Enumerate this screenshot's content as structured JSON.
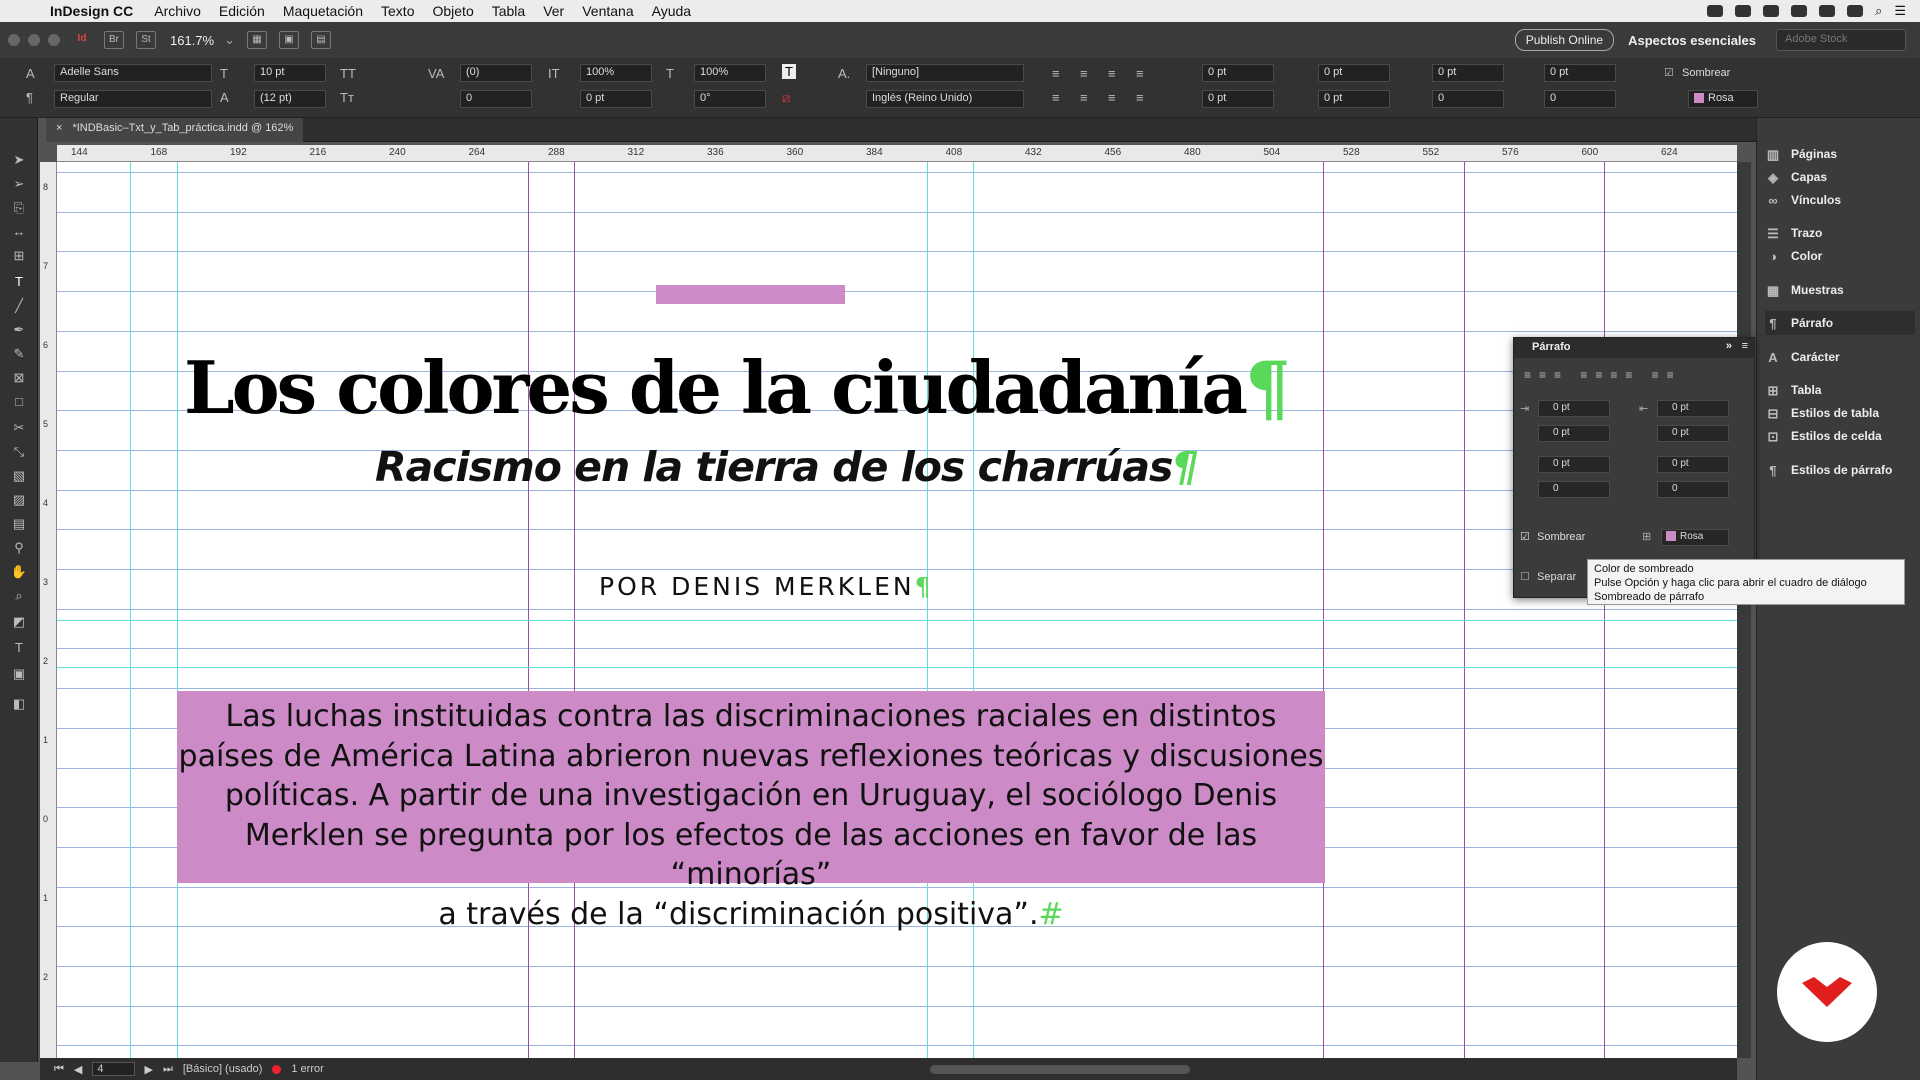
{
  "menubar": {
    "app_name": "InDesign CC",
    "items": [
      "Archivo",
      "Edición",
      "Maquetación",
      "Texto",
      "Objeto",
      "Tabla",
      "Ver",
      "Ventana",
      "Ayuda"
    ]
  },
  "appbar": {
    "zoom": "161.7%",
    "publish": "Publish Online",
    "workspace": "Aspectos esenciales",
    "stock_placeholder": "Adobe Stock",
    "br": "Br",
    "st": "St"
  },
  "control": {
    "font_family": "Adelle Sans",
    "font_style": "Regular",
    "font_size": "10 pt",
    "leading": "(12 pt)",
    "kerning": "(0)",
    "tracking": "0",
    "vscale": "100%",
    "hscale": "100%",
    "baseline": "0 pt",
    "skew": "0°",
    "char_style": "[Ninguno]",
    "language": "Inglés (Reino Unido)",
    "indent_fields": [
      "0 pt",
      "0 pt",
      "0 pt",
      "0 pt",
      "0 pt",
      "0 pt",
      "0",
      "0"
    ],
    "shade_label": "Sombrear",
    "shade_color": "Rosa"
  },
  "document_tab": "*INDBasic–Txt_y_Tab_práctica.indd @ 162%",
  "ruler": {
    "h_ticks": [
      "144",
      "168",
      "192",
      "216",
      "240",
      "264",
      "288",
      "312",
      "336",
      "360",
      "384",
      "408",
      "432",
      "456",
      "480",
      "504",
      "528",
      "552",
      "576",
      "600",
      "624"
    ],
    "v_ticks": [
      "8",
      "7",
      "6",
      "5",
      "4",
      "3",
      "2",
      "1",
      "0",
      "1",
      "2"
    ]
  },
  "article": {
    "title": "Los colores de la ciudadanía",
    "subtitle": "Racismo en la tierra de los charrúas",
    "author": "POR DENIS MERKLEN",
    "lead": [
      "Las luchas instituidas contra las discriminaciones raciales en distintos",
      "países de América Latina abrieron nuevas reflexiones teóricas y discusiones",
      "políticas. A partir de una investigación en Uruguay, el sociólogo Denis",
      "Merklen se pregunta por los efectos de las acciones en favor de las “minorías”",
      "a través de la “discriminación positiva”."
    ],
    "pilcrow": "¶",
    "end_mark": "#"
  },
  "status": {
    "page": "4",
    "style": "[Básico] (usado)",
    "errors": "1 error"
  },
  "dock": [
    "Páginas",
    "Capas",
    "Vínculos",
    "Trazo",
    "Color",
    "Muestras",
    "Párrafo",
    "Carácter",
    "Tabla",
    "Estilos de tabla",
    "Estilos de celda",
    "Estilos de párrafo"
  ],
  "paragraph_panel": {
    "title": "Párrafo",
    "fields": [
      "0 pt",
      "0 pt",
      "0 pt",
      "0 pt",
      "0 pt",
      "0 pt",
      "0",
      "0"
    ],
    "shade_label": "Sombrear",
    "shade_color": "Rosa",
    "separate_label": "Separar"
  },
  "tooltip": {
    "line1": "Color de sombreado",
    "line2": "Pulse Opción y haga clic para abrir el cuadro de diálogo",
    "line3": "Sombreado de párrafo"
  },
  "colors": {
    "rosa": "#cc8ac7",
    "guide_cyan": "#5fe0dc",
    "guide_purple": "#9b4fa8",
    "margin_blue": "#7fa2d8"
  }
}
